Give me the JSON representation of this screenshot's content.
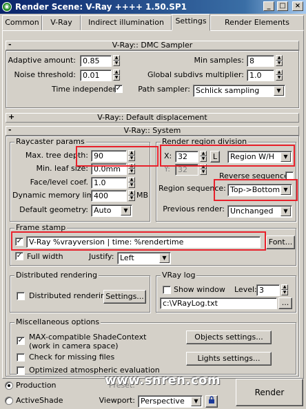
{
  "window": {
    "title": "Render Scene: V-Ray ++++ 1.50.SP1",
    "minimize": "_",
    "maximize": "□",
    "close": "×"
  },
  "tabs": [
    {
      "label": "Common"
    },
    {
      "label": "V-Ray"
    },
    {
      "label": "Indirect illumination"
    },
    {
      "label": "Settings"
    },
    {
      "label": "Render Elements"
    }
  ],
  "dmc": {
    "header": "V-Ray:: DMC Sampler",
    "sign": "-",
    "adaptive_label": "Adaptive amount:",
    "adaptive_value": "0.85",
    "noise_label": "Noise threshold:",
    "noise_value": "0.01",
    "time_indep_label": "Time independent",
    "time_indep_checked": "✓",
    "min_samples_label": "Min samples:",
    "min_samples_value": "8",
    "subdivs_label": "Global subdivs multiplier:",
    "subdivs_value": "1.0",
    "path_label": "Path sampler:",
    "path_value": "Schlick sampling"
  },
  "displacement": {
    "header": "V-Ray:: Default displacement",
    "sign": "+"
  },
  "system": {
    "header": "V-Ray:: System",
    "sign": "-",
    "raycaster": {
      "title": "Raycaster params",
      "max_depth_label": "Max. tree depth:",
      "max_depth_value": "90",
      "min_leaf_label": "Min. leaf size:",
      "min_leaf_value": "0.0mm",
      "face_label": "Face/level coef.",
      "face_value": "1.0",
      "memory_label": "Dynamic memory limit:",
      "memory_value": "400",
      "memory_unit": "MB",
      "geometry_label": "Default geometry:",
      "geometry_value": "Auto"
    },
    "region": {
      "title": "Render region division",
      "x_label": "X:",
      "x_value": "32",
      "lock": "L",
      "y_label": "Y:",
      "y_value": "32",
      "mode_value": "Region W/H",
      "reverse_label": "Reverse sequence",
      "sequence_label": "Region sequence:",
      "sequence_value": "Top->Bottom",
      "previous_label": "Previous render:",
      "previous_value": "Unchanged"
    },
    "frame_stamp": {
      "title": "Frame stamp",
      "checked": "✓",
      "value": "V-Ray %vrayversion | time: %rendertime",
      "font_button": "Font...",
      "full_width_label": "Full width",
      "full_width_checked": "✓",
      "justify_label": "Justify:",
      "justify_value": "Left"
    },
    "distributed": {
      "title": "Distributed rendering",
      "checkbox_label": "Distributed rendering",
      "settings_button": "Settings..."
    },
    "vraylog": {
      "title": "VRay log",
      "show_label": "Show window",
      "level_label": "Level:",
      "level_value": "3",
      "path_value": "c:\\VRayLog.txt",
      "browse": "..."
    },
    "misc": {
      "title": "Miscellaneous options",
      "maxcompat_label": "MAX-compatible ShadeContext",
      "maxcompat_sub": "(work in camera space)",
      "maxcompat_checked": "✓",
      "missing_label": "Check for missing files",
      "optimized_label": "Optimized atmospheric evaluation",
      "objects_button": "Objects settings...",
      "lights_button": "Lights settings..."
    }
  },
  "bottom": {
    "production_label": "Production",
    "activeshade_label": "ActiveShade",
    "preset_label": "Preset:",
    "viewport_label": "Viewport:",
    "viewport_value": "Perspective",
    "render_button": "Render"
  },
  "watermark": "www.snren.com"
}
